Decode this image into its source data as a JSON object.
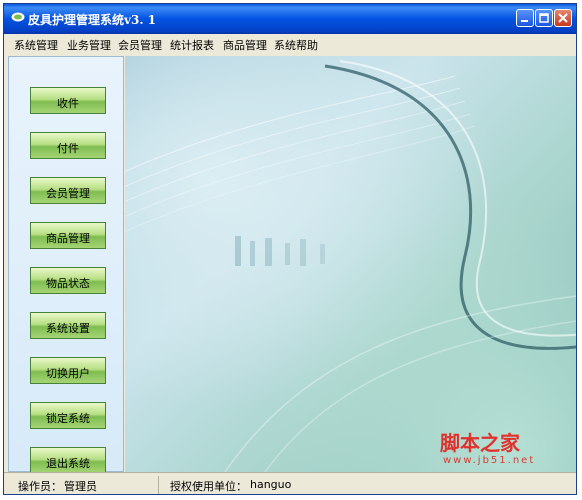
{
  "window": {
    "title": "皮具护理管理系统v3. 1"
  },
  "menu": [
    "系统管理",
    "业务管理",
    "会员管理",
    "统计报表",
    "商品管理",
    "系统帮助"
  ],
  "sidebar": {
    "buttons": [
      "收件",
      "付件",
      "会员管理",
      "商品管理",
      "物品状态",
      "系统设置",
      "切换用户",
      "锁定系统",
      "退出系统"
    ]
  },
  "status": {
    "operator_label": "操作员：",
    "operator_value": "管理员",
    "unit_label": "授权使用单位：",
    "unit_value": "hanguo"
  },
  "watermark": {
    "text": "脚本之家",
    "url": "www.jb51.net"
  },
  "colors": {
    "titlebar": "#0554e3",
    "button_green": "#7fbd52",
    "watermark_red": "#e0312c"
  }
}
